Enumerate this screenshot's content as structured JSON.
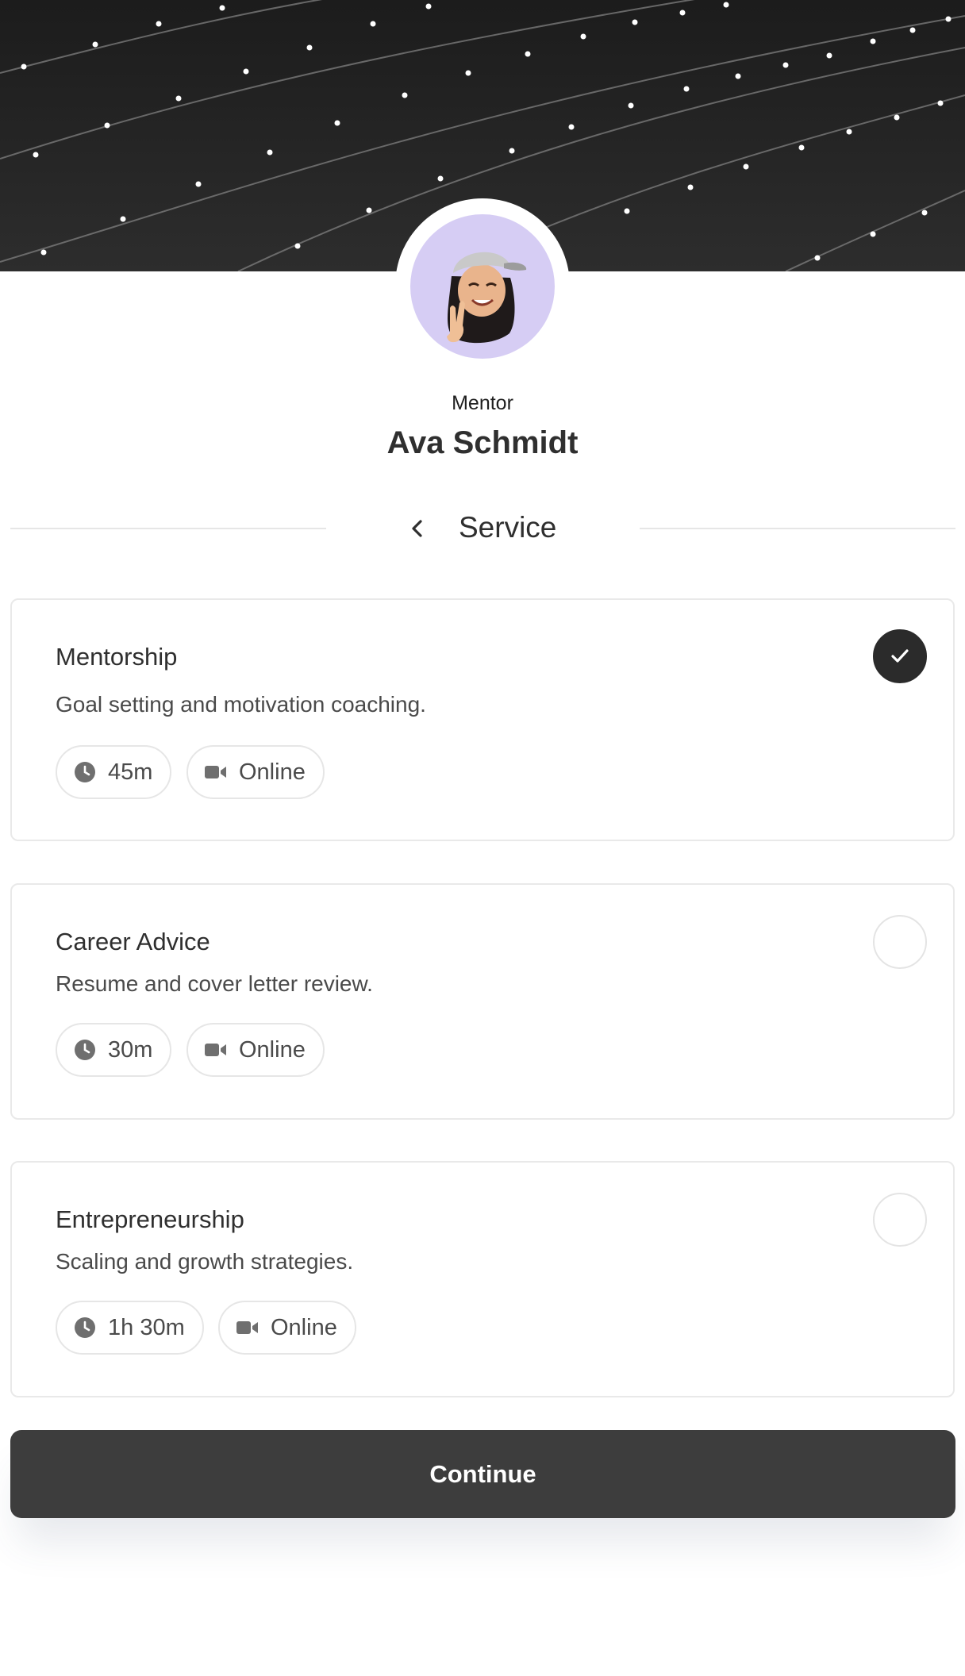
{
  "profile": {
    "role": "Mentor",
    "name": "Ava Schmidt",
    "avatar": "memoji-avatar"
  },
  "section": {
    "title": "Service",
    "back_icon": "chevron-left-icon"
  },
  "services": [
    {
      "title": "Mentorship",
      "description": "Goal setting and motivation coaching.",
      "duration": "45m",
      "location": "Online",
      "selected": true
    },
    {
      "title": "Career Advice",
      "description": "Resume and cover letter review.",
      "duration": "30m",
      "location": "Online",
      "selected": false
    },
    {
      "title": "Entrepreneurship",
      "description": "Scaling and growth strategies.",
      "duration": "1h 30m",
      "location": "Online",
      "selected": false
    }
  ],
  "actions": {
    "continue_label": "Continue"
  },
  "colors": {
    "banner": "#262626",
    "avatar_bg": "#d6cdf4",
    "primary_button": "#3d3d3d",
    "selected_radio": "#2b2b2b",
    "border": "#e9e9e9"
  }
}
